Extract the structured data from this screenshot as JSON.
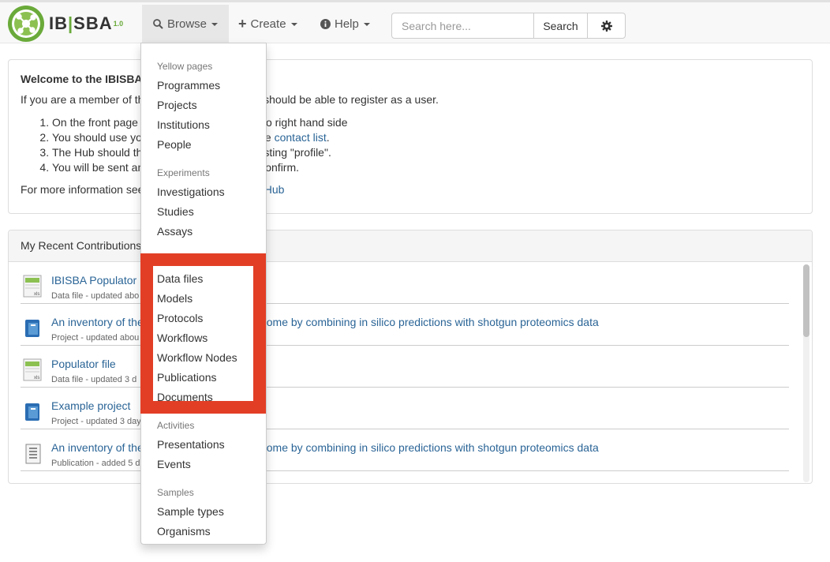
{
  "brand": {
    "name_part1": "IB",
    "name_bar": "|",
    "name_part2": "SBA",
    "version": "1.0"
  },
  "nav": {
    "browse": "Browse",
    "create": "Create",
    "help": "Help",
    "search_placeholder": "Search here...",
    "search_button": "Search"
  },
  "welcome": {
    "title": "Welcome to the IBISBA",
    "intro": "If you are a member of th",
    "intro_tail": "u should be able to register as a user.",
    "steps": [
      {
        "head": "On the front page",
        "tail": "o right hand side"
      },
      {
        "head": "You should use yo",
        "tail": "e ",
        "link": "contact list",
        "end": "."
      },
      {
        "head": "The Hub should th",
        "tail": "sting \"profile\"."
      },
      {
        "head": "You will be sent an",
        "tail": "confirm."
      }
    ],
    "more": "For more information see",
    "more_link": "AHub"
  },
  "recent": {
    "title": "My Recent Contributions",
    "items": [
      {
        "title": "IBISBA Populator",
        "title_tail": "",
        "meta": "Data file - updated abo",
        "icon": "spreadsheet-icon"
      },
      {
        "title": "An inventory of the",
        "title_tail": "ome by combining in silico predictions with shotgun proteomics data",
        "meta": "Project - updated abou",
        "icon": "project-icon"
      },
      {
        "title": "Populator file",
        "title_tail": "",
        "meta": "Data file - updated 3 d",
        "icon": "spreadsheet-icon"
      },
      {
        "title": "Example project",
        "title_tail": "",
        "meta": "Project - updated 3 day",
        "icon": "project-icon"
      },
      {
        "title": "An inventory of the",
        "title_tail": "ome by combining in silico predictions with shotgun proteomics data",
        "meta": "Publication - added 5 d",
        "icon": "publication-icon"
      }
    ]
  },
  "browse_menu": {
    "sections": [
      {
        "header": "Yellow pages",
        "items": [
          "Programmes",
          "Projects",
          "Institutions",
          "People"
        ]
      },
      {
        "header": "Experiments",
        "items": [
          "Investigations",
          "Studies",
          "Assays"
        ]
      },
      {
        "header": "",
        "items": [
          "Data files",
          "Models",
          "Protocols",
          "Workflows",
          "Workflow Nodes",
          "Publications",
          "Documents"
        ]
      },
      {
        "header": "Activities",
        "items": [
          "Presentations",
          "Events"
        ]
      },
      {
        "header": "Samples",
        "items": [
          "Sample types",
          "Organisms"
        ]
      }
    ]
  },
  "colors": {
    "highlight": "#e23e26",
    "link": "#2a6496",
    "brand_green": "#6aaa3a"
  }
}
